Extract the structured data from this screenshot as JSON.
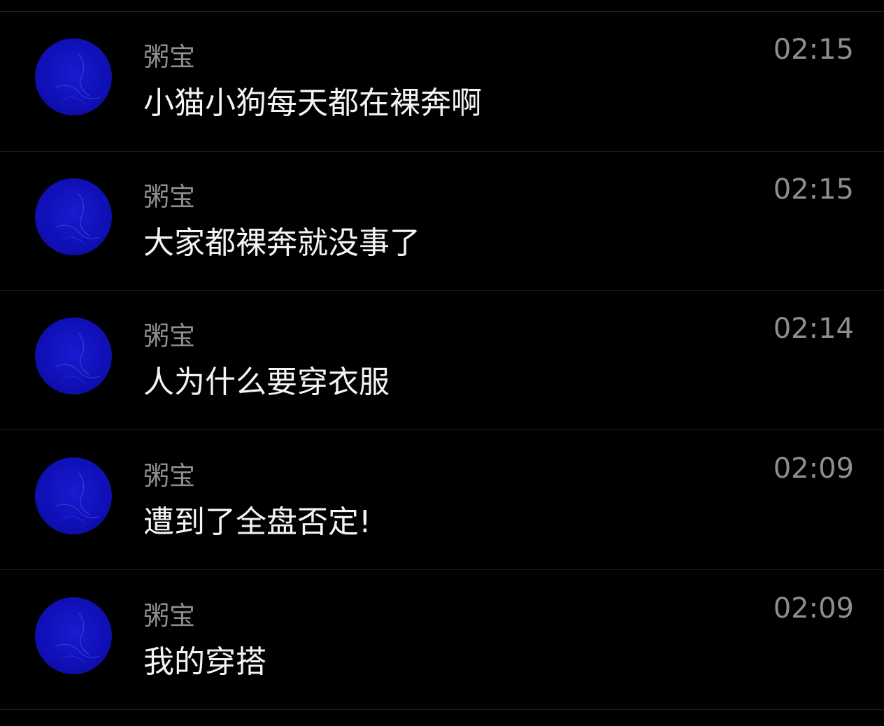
{
  "colors": {
    "background": "#000000",
    "divider": "#1d1d1d",
    "avatar": "#1414c8",
    "secondary_text": "#8e8e8e",
    "primary_text": "#f4f4f4"
  },
  "messages": [
    {
      "sender": "粥宝",
      "text": "小猫小狗每天都在裸奔啊",
      "time": "02:15",
      "avatar_icon": "blue-avatar-icon"
    },
    {
      "sender": "粥宝",
      "text": "大家都裸奔就没事了",
      "time": "02:15",
      "avatar_icon": "blue-avatar-icon"
    },
    {
      "sender": "粥宝",
      "text": "人为什么要穿衣服",
      "time": "02:14",
      "avatar_icon": "blue-avatar-icon"
    },
    {
      "sender": "粥宝",
      "text": "遭到了全盘否定!",
      "time": "02:09",
      "avatar_icon": "blue-avatar-icon"
    },
    {
      "sender": "粥宝",
      "text": "我的穿搭",
      "time": "02:09",
      "avatar_icon": "blue-avatar-icon"
    }
  ]
}
